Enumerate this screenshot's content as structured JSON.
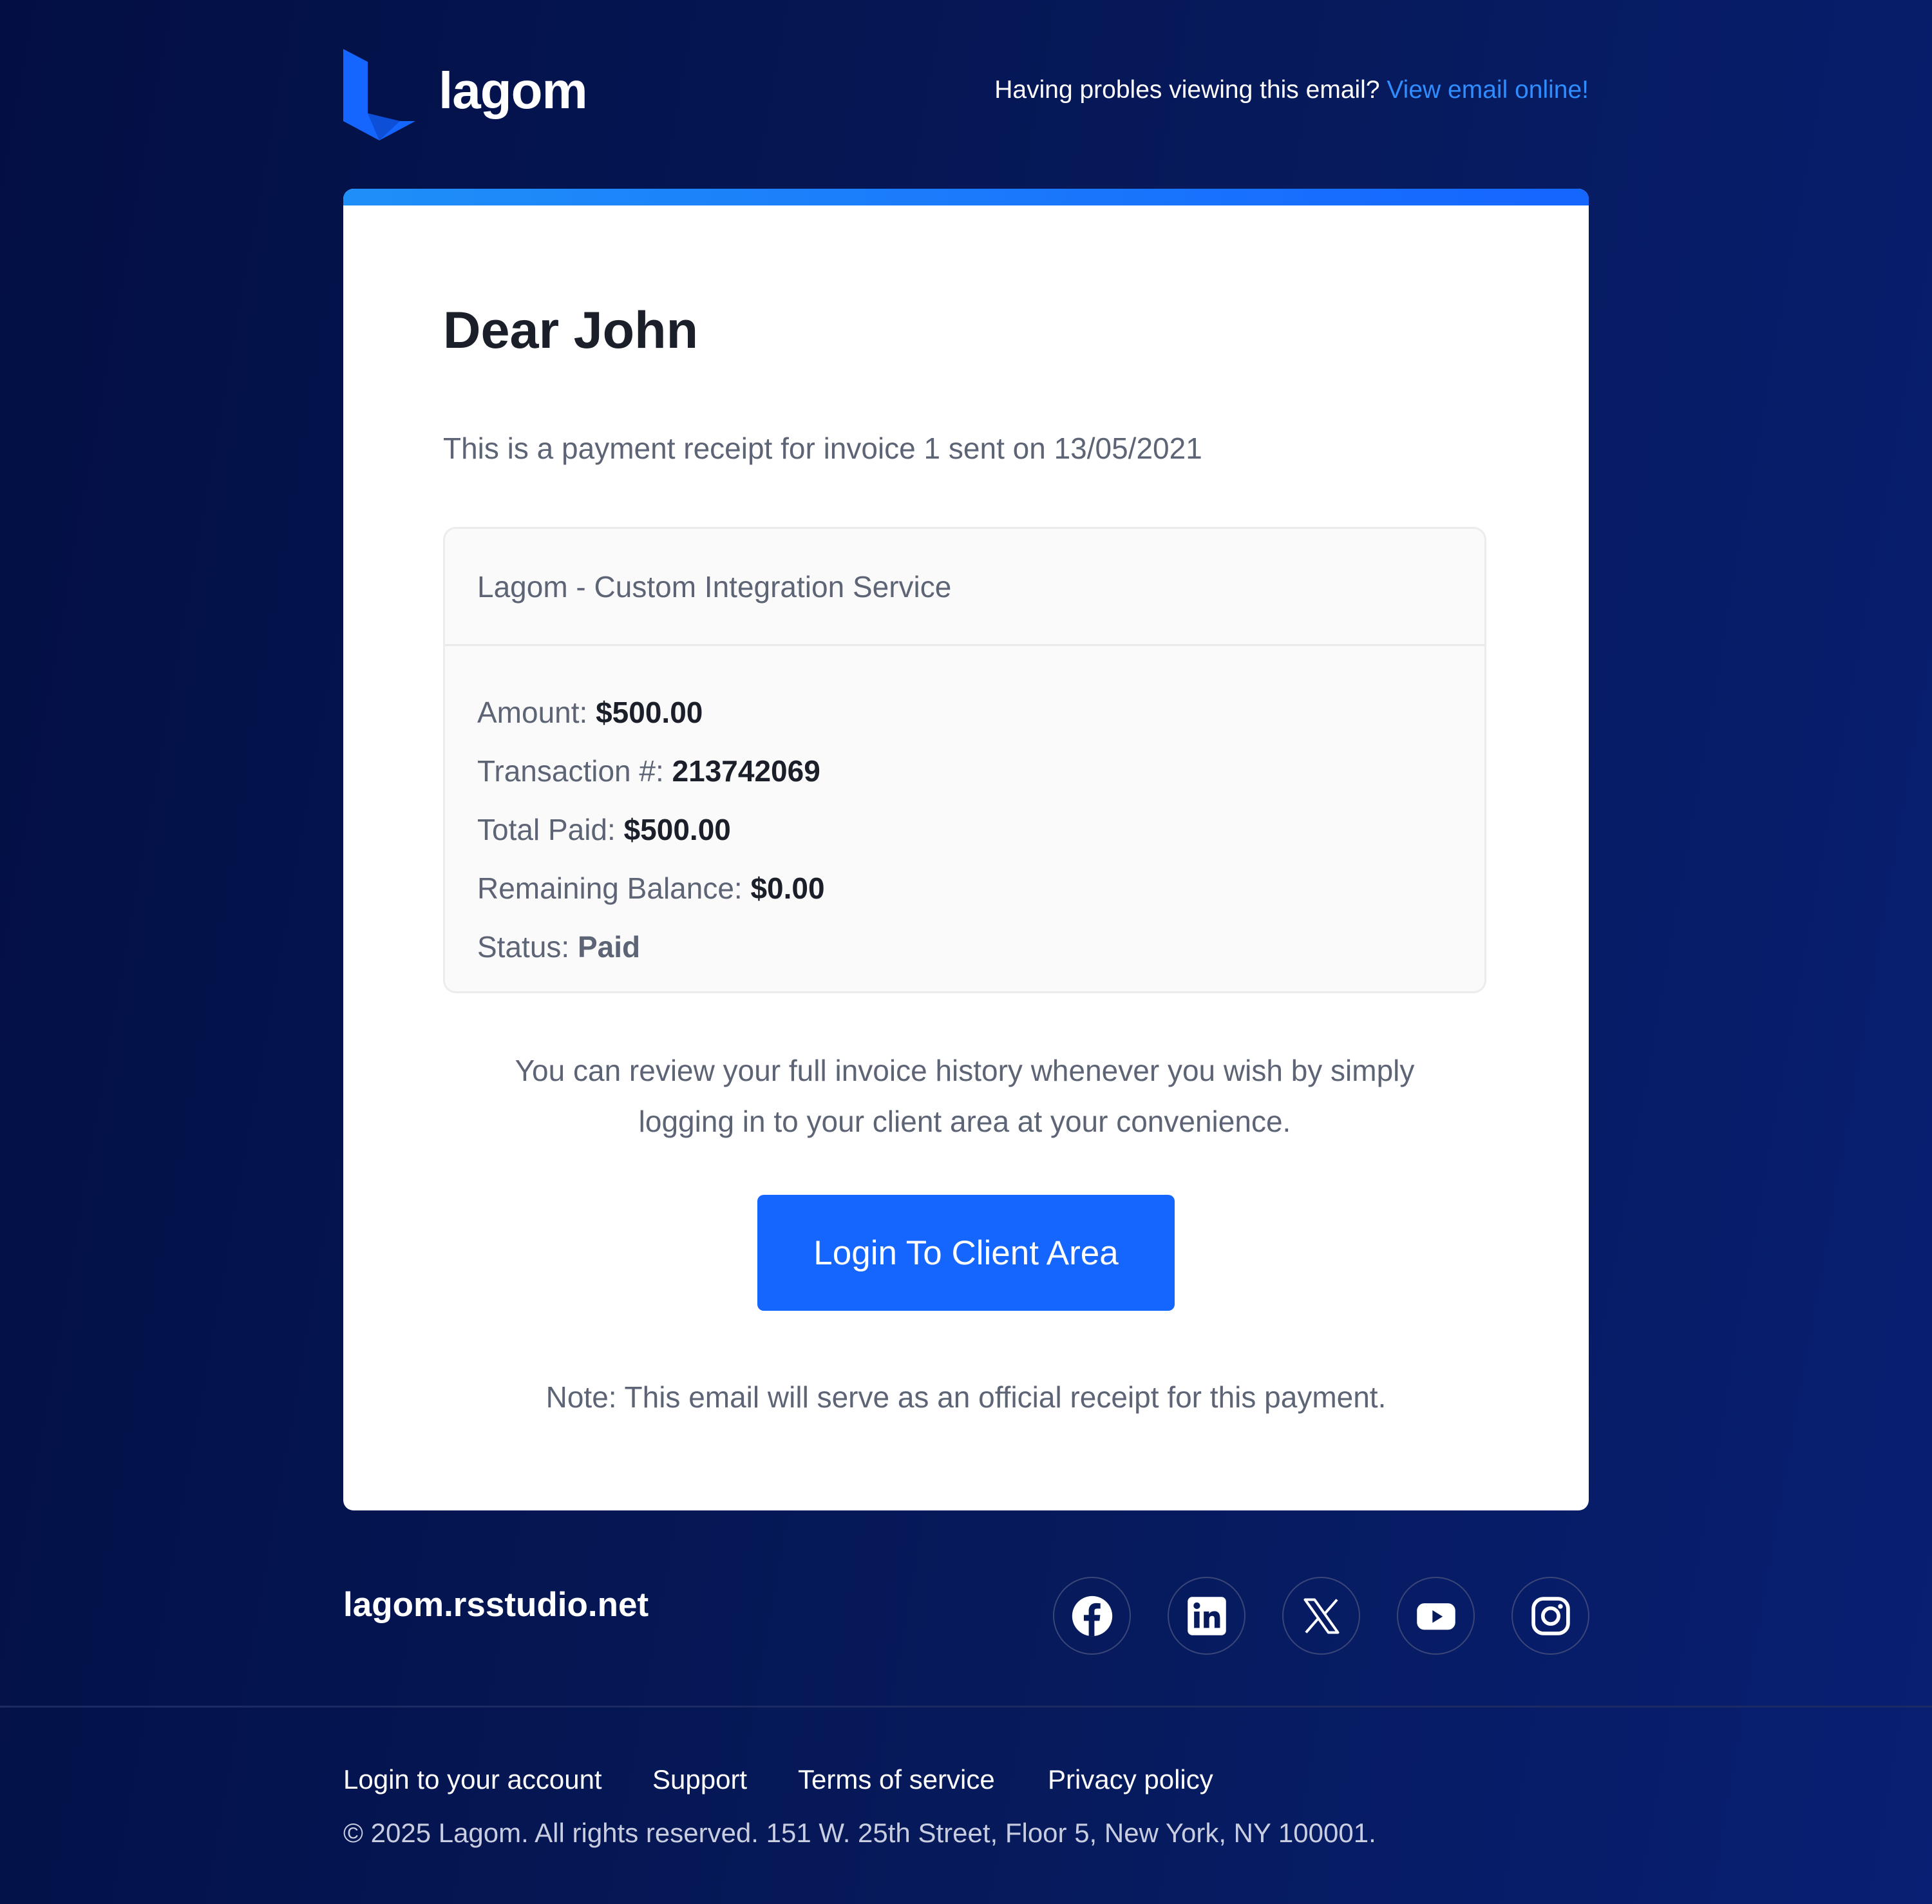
{
  "header": {
    "logo_text": "lagom",
    "help_prefix": "Having probles viewing this email?",
    "view_online_link": "View email online!"
  },
  "card": {
    "greeting": "Dear John",
    "intro": "This is a payment receipt for invoice 1 sent on 13/05/2021",
    "details": {
      "service": "Lagom - Custom Integration Service",
      "rows": [
        {
          "label": "Amount:",
          "value": "$500.00"
        },
        {
          "label": "Transaction #:",
          "value": "213742069"
        },
        {
          "label": "Total Paid:",
          "value": "$500.00"
        },
        {
          "label": "Remaining Balance:",
          "value": "$0.00"
        },
        {
          "label": "Status:",
          "value": "Paid"
        }
      ]
    },
    "history_line1": "You can review your full invoice history whenever you wish by simply",
    "history_line2": "logging in to your client area at your convenience.",
    "login_button": "Login To Client Area",
    "note": "Note: This email will serve as an official receipt for this payment."
  },
  "footer": {
    "site": "lagom.rsstudio.net",
    "socials": [
      "facebook-icon",
      "linkedin-icon",
      "x-icon",
      "youtube-icon",
      "instagram-icon"
    ],
    "links": [
      "Login to your account",
      "Support",
      "Terms of service",
      "Privacy policy"
    ],
    "copyright": "© 2025 Lagom. All rights reserved. 151 W. 25th Street, Floor 5, New York, NY 100001."
  },
  "colors": {
    "background": "#061a5c",
    "accent": "#1565ff",
    "link": "#2f8dff"
  }
}
